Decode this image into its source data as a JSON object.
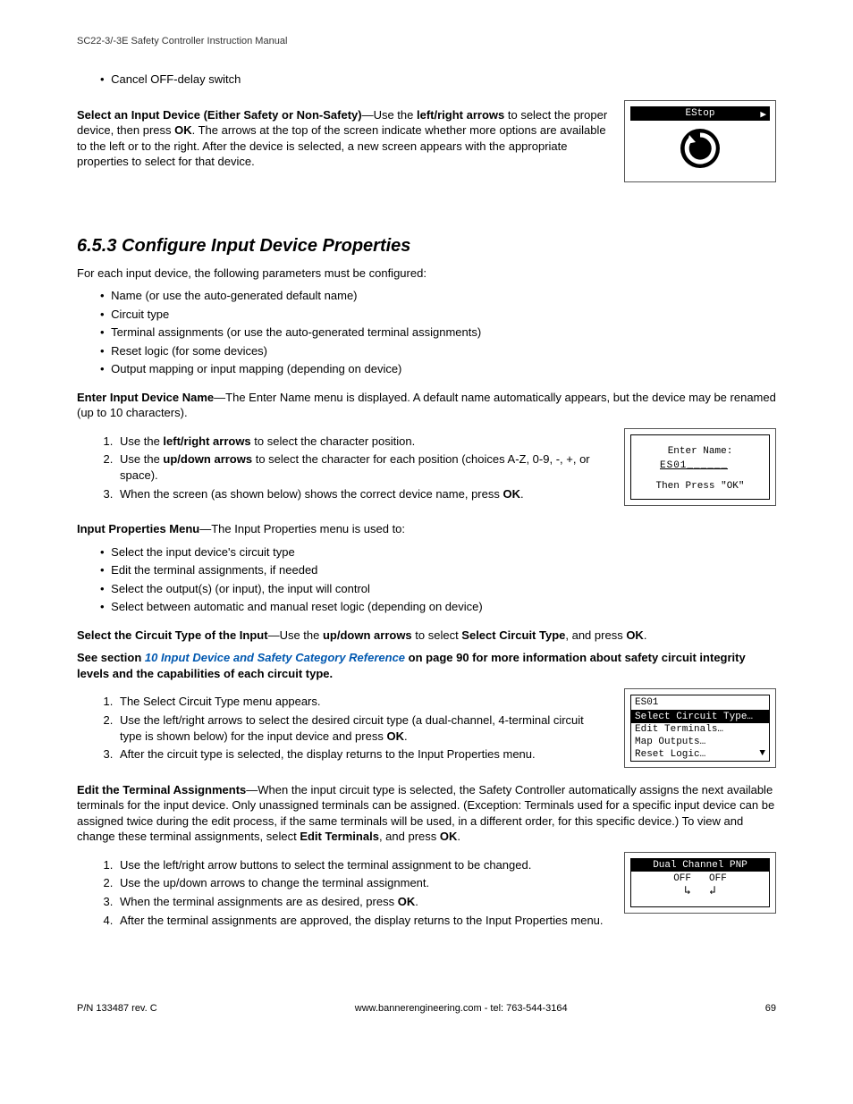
{
  "header": {
    "title": "SC22-3/-3E Safety Controller Instruction Manual"
  },
  "intro_bullets": [
    "Cancel OFF-delay switch"
  ],
  "select_device": {
    "lead_bold": "Select an Input Device (Either Safety or Non-Safety)",
    "body1": "—Use the ",
    "arrows": "left/right arrows",
    "body2": " to select the proper device, then press ",
    "ok": "OK",
    "body3": ". The arrows at the top of the screen indicate whether more options are available to the left or to the right. After the device is selected, a new screen appears with the appropriate properties to select for that device."
  },
  "lcd_estop": {
    "label": "EStop"
  },
  "section": {
    "heading": "6.5.3 Configure Input Device Properties",
    "intro": "For each input device, the following parameters must be configured:",
    "params": [
      "Name (or use the auto-generated default name)",
      "Circuit type",
      "Terminal assignments (or use the auto-generated terminal assignments)",
      "Reset logic (for some devices)",
      "Output mapping or input mapping (depending on device)"
    ]
  },
  "enter_name": {
    "lead_bold": "Enter Input Device Name",
    "rest": "—The Enter Name menu is displayed. A default name automatically appears, but the device may be renamed (up to 10 characters).",
    "step1_a": "Use the ",
    "step1_b": "left/right arrows",
    "step1_c": " to select the character position.",
    "step2_a": "Use the ",
    "step2_b": "up/down arrows",
    "step2_c": " to select the character for each position (choices A-Z, 0-9, -, +, or space).",
    "step3_a": "When the screen (as shown below) shows the correct device name, press ",
    "step3_b": "OK",
    "step3_c": "."
  },
  "lcd_entername": {
    "line1": "Enter Name:",
    "value": "ES01______",
    "line3": "Then Press \"OK\""
  },
  "input_props": {
    "lead_bold": "Input Properties Menu",
    "rest": "—The Input Properties menu is used to:",
    "items": [
      "Select the input device's circuit type",
      "Edit the terminal assignments, if needed",
      "Select the output(s) (or input), the input will control",
      "Select between automatic and manual reset logic (depending on device)"
    ]
  },
  "select_circuit": {
    "lead_bold": "Select the Circuit Type of the Input",
    "body1": "—Use the ",
    "arrows": "up/down arrows",
    "body2": " to select ",
    "target": "Select Circuit Type",
    "body3": ", and press ",
    "ok": "OK",
    "body4": "."
  },
  "see_section": {
    "pre": "See section ",
    "link": "10 Input Device and Safety Category Reference",
    "post1": " on page 90 for more information about safety circuit integrity levels and the capabilities of each circuit type."
  },
  "circuit_steps": {
    "s1": "The Select Circuit Type menu appears.",
    "s2_a": "Use the left/right arrows to select the desired circuit type (a dual-channel, 4-terminal circuit type is shown below) for the input device and press ",
    "s2_b": "OK",
    "s2_c": ".",
    "s3": "After the circuit type is selected, the display returns to the Input Properties menu."
  },
  "lcd_menu": {
    "title": "ES01",
    "selected": "Select Circuit Type…",
    "items": [
      "Edit Terminals…",
      "Map Outputs…",
      "Reset Logic…"
    ]
  },
  "edit_terminals": {
    "lead_bold": "Edit the Terminal Assignments",
    "body_a": "—When the input circuit type is selected, the Safety Controller automatically assigns the next available terminals for the input device. Only unassigned terminals can be assigned. (Exception: Terminals used for a specific input device can be assigned twice during the edit process, if the same terminals will be used, in a different order, for this specific device.) To view and change these terminal assignments, select ",
    "edit": "Edit Terminals",
    "body_b": ", and press ",
    "ok": "OK",
    "body_c": "."
  },
  "terminal_steps": {
    "s1": "Use the left/right arrow buttons to select the terminal assignment to be changed.",
    "s2": "Use the up/down arrows to change the terminal assignment.",
    "s3_a": "When the terminal assignments are as desired, press ",
    "s3_b": "OK",
    "s3_c": ".",
    "s4": "After the terminal assignments are approved, the display returns to the Input Properties menu."
  },
  "lcd_dual": {
    "header": "Dual Channel PNP",
    "off": "OFF"
  },
  "footer": {
    "left": "P/N 133487 rev. C",
    "center": "www.bannerengineering.com - tel: 763-544-3164",
    "right": "69"
  }
}
